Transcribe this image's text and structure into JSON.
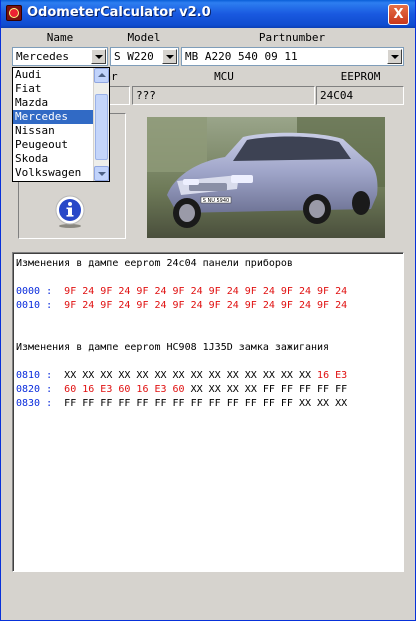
{
  "window": {
    "title": "OdometerCalculator v2.0",
    "close_label": "X"
  },
  "labels": {
    "name": "Name",
    "model": "Model",
    "partnumber": "Partnumber",
    "year_partial": "ar",
    "mcu": "MCU",
    "eeprom": "EEPROM"
  },
  "fields": {
    "name": "Mercedes",
    "model": "S W220",
    "partnumber": "MB A220 540 09 11",
    "mcu": "???",
    "eeprom": "24C04"
  },
  "name_dropdown": {
    "options": [
      "Audi",
      "Fiat",
      "Mazda",
      "Mercedes",
      "Nissan",
      "Peugeout",
      "Skoda",
      "Volkswagen"
    ],
    "selected": "Mercedes"
  },
  "car_image": {
    "plate": "S NU 5940",
    "color": "silver-blue"
  },
  "log": {
    "header1": "Изменения в дампе eeprom 24c04 панели приборов",
    "dump1": [
      {
        "addr": "0000 :",
        "bytes": "9F 24 9F 24 9F 24 9F 24 9F 24 9F 24 9F 24 9F 24"
      },
      {
        "addr": "0010 :",
        "bytes": "9F 24 9F 24 9F 24 9F 24 9F 24 9F 24 9F 24 9F 24"
      }
    ],
    "header2": "Изменения в дампе eeprom HC908 1J35D замка зажигания",
    "dump2": [
      {
        "addr": "0810 :",
        "black": "XX XX XX XX XX XX XX XX XX XX XX XX XX XX ",
        "red": "16 E3"
      },
      {
        "addr": "0820 :",
        "red": "60 16 E3 60 16 E3 60 ",
        "black": "XX XX XX XX FF FF FF FF FF"
      },
      {
        "addr": "0830 :",
        "black": "FF FF FF FF FF FF FF FF FF FF FF FF FF XX XX XX"
      }
    ]
  },
  "colors": {
    "address": "#0a2cdc",
    "changed": "#e01010",
    "selection": "#316ac5"
  }
}
